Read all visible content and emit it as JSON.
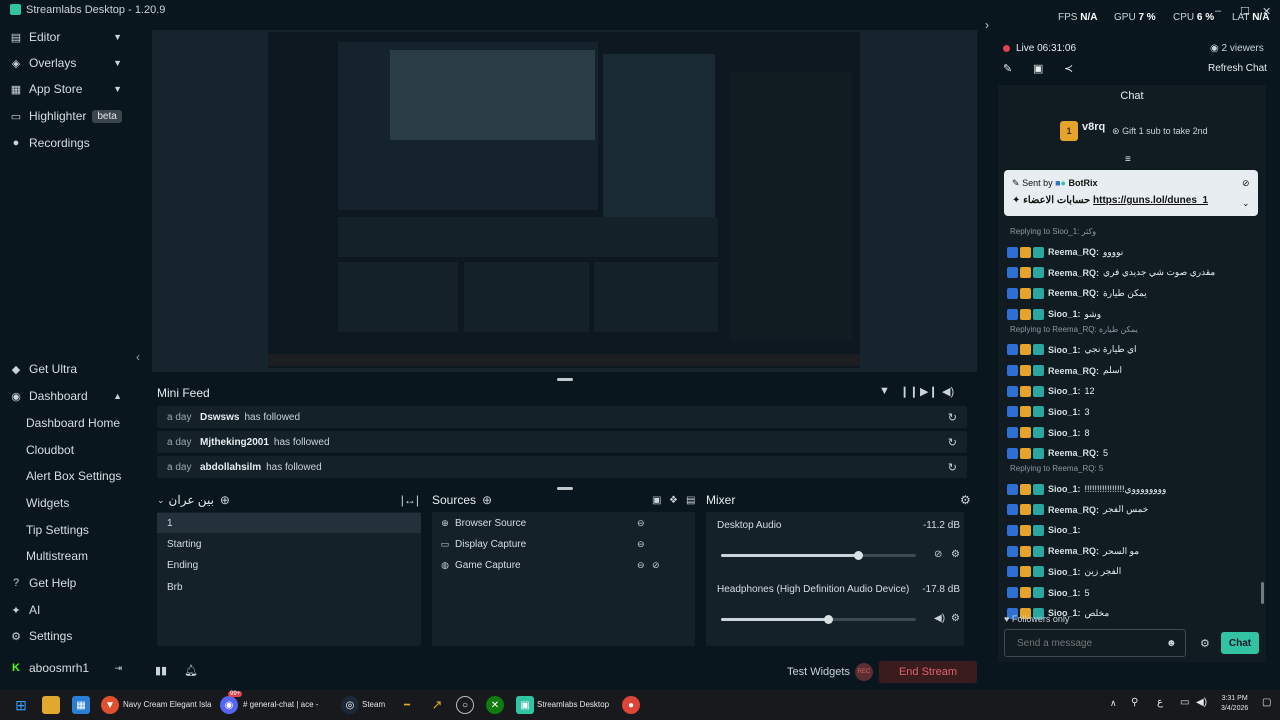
{
  "titlebar": {
    "title": "Streamlabs Desktop - 1.20.9",
    "fps_label": "FPS",
    "fps": "N/A",
    "gpu_label": "GPU",
    "gpu": "7 %",
    "cpu_label": "CPU",
    "cpu": "6 %",
    "lat_label": "LAT",
    "lat": "N/A"
  },
  "sidebar": {
    "top": [
      {
        "label": "Editor",
        "icon": "editor-icon"
      },
      {
        "label": "Overlays",
        "icon": "overlays-icon"
      },
      {
        "label": "App Store",
        "icon": "app-store-icon"
      },
      {
        "label": "Highlighter",
        "icon": "highlighter-icon",
        "badge": "beta"
      },
      {
        "label": "Recordings",
        "icon": "recordings-icon"
      }
    ],
    "get_ultra": "Get Ultra",
    "dashboard": "Dashboard",
    "dashboard_items": [
      "Dashboard Home",
      "Cloudbot",
      "Alert Box Settings",
      "Widgets",
      "Tip Settings",
      "Multistream"
    ],
    "get_help": "Get Help",
    "ai": "AI",
    "settings": "Settings",
    "user": "aboosmrh1"
  },
  "minifeed": {
    "title": "Mini Feed",
    "rows": [
      {
        "when": "a day",
        "who": "Dswsws",
        "action": "has followed"
      },
      {
        "when": "a day",
        "who": "Mjtheking2001",
        "action": "has followed"
      },
      {
        "when": "a day",
        "who": "abdollahsilm",
        "action": "has followed"
      }
    ]
  },
  "scenes": {
    "title": "بين عران",
    "items": [
      "1",
      "Starting",
      "Ending",
      "Brb"
    ]
  },
  "sources": {
    "title": "Sources",
    "items": [
      "Browser Source",
      "Display Capture",
      "Game Capture"
    ]
  },
  "mixer": {
    "title": "Mixer",
    "channels": [
      {
        "name": "Desktop Audio",
        "db": "-11.2 dB",
        "level": 0.7
      },
      {
        "name": "Headphones (High Definition Audio Device)",
        "db": "-17.8 dB",
        "level": 0.55
      }
    ]
  },
  "footer": {
    "test_widgets": "Test Widgets",
    "end_stream": "End Stream",
    "rec_label": "REC"
  },
  "chat": {
    "live": "Live 06:31:06",
    "viewers": "2 viewers",
    "refresh": "Refresh Chat",
    "title": "Chat",
    "pinned_user": "v8rq",
    "pinned_level": "1",
    "gift": "Gift 1 sub to take 2nd",
    "sent_by_label": "Sent by",
    "sent_by": "BotRix",
    "pinned_text": "حسابات الاعضاء",
    "pinned_link": "https://guns.lol/dunes_1",
    "messages": [
      {
        "reply": "Replying to Sioo_1: وكثر"
      },
      {
        "user": "Reema_RQ:",
        "text": "نوووو"
      },
      {
        "user": "Reema_RQ:",
        "text": "مقدري صوت شي جديدي فري"
      },
      {
        "user": "Reema_RQ:",
        "text": "يمكن طيارة"
      },
      {
        "user": "Sioo_1:",
        "text": "وشو"
      },
      {
        "reply": "Replying to Reema_RQ: يمكن طيارة"
      },
      {
        "user": "Sioo_1:",
        "text": "اي طيارة نجي"
      },
      {
        "user": "Reema_RQ:",
        "text": "اسلم"
      },
      {
        "user": "Sioo_1:",
        "text": "12"
      },
      {
        "user": "Sioo_1:",
        "text": "3"
      },
      {
        "user": "Sioo_1:",
        "text": "8"
      },
      {
        "user": "Reema_RQ:",
        "text": "5"
      },
      {
        "reply": "Replying to Reema_RQ: 5"
      },
      {
        "user": "Sioo_1:",
        "text": "!!!!!!!!!!!!!!!!ووووووووي"
      },
      {
        "user": "Reema_RQ:",
        "text": "خمس الفجر"
      },
      {
        "user": "Sioo_1:",
        "text": ""
      },
      {
        "user": "Reema_RQ:",
        "text": "مو السحر"
      },
      {
        "user": "Sioo_1:",
        "text": "الفجر زين"
      },
      {
        "user": "Sioo_1:",
        "text": "5"
      },
      {
        "user": "Sioo_1:",
        "text": "مخلص"
      }
    ],
    "followers_only": "Followers only",
    "placeholder": "Send a message",
    "send": "Chat"
  },
  "taskbar": {
    "items": [
      "Navy Cream Elegant Isla",
      "# general-chat | ace -",
      "Steam",
      "Streamlabs Desktop"
    ],
    "time": "3:31 PM",
    "date": "3/4/2026",
    "lang": "ع",
    "notif": "99+"
  }
}
